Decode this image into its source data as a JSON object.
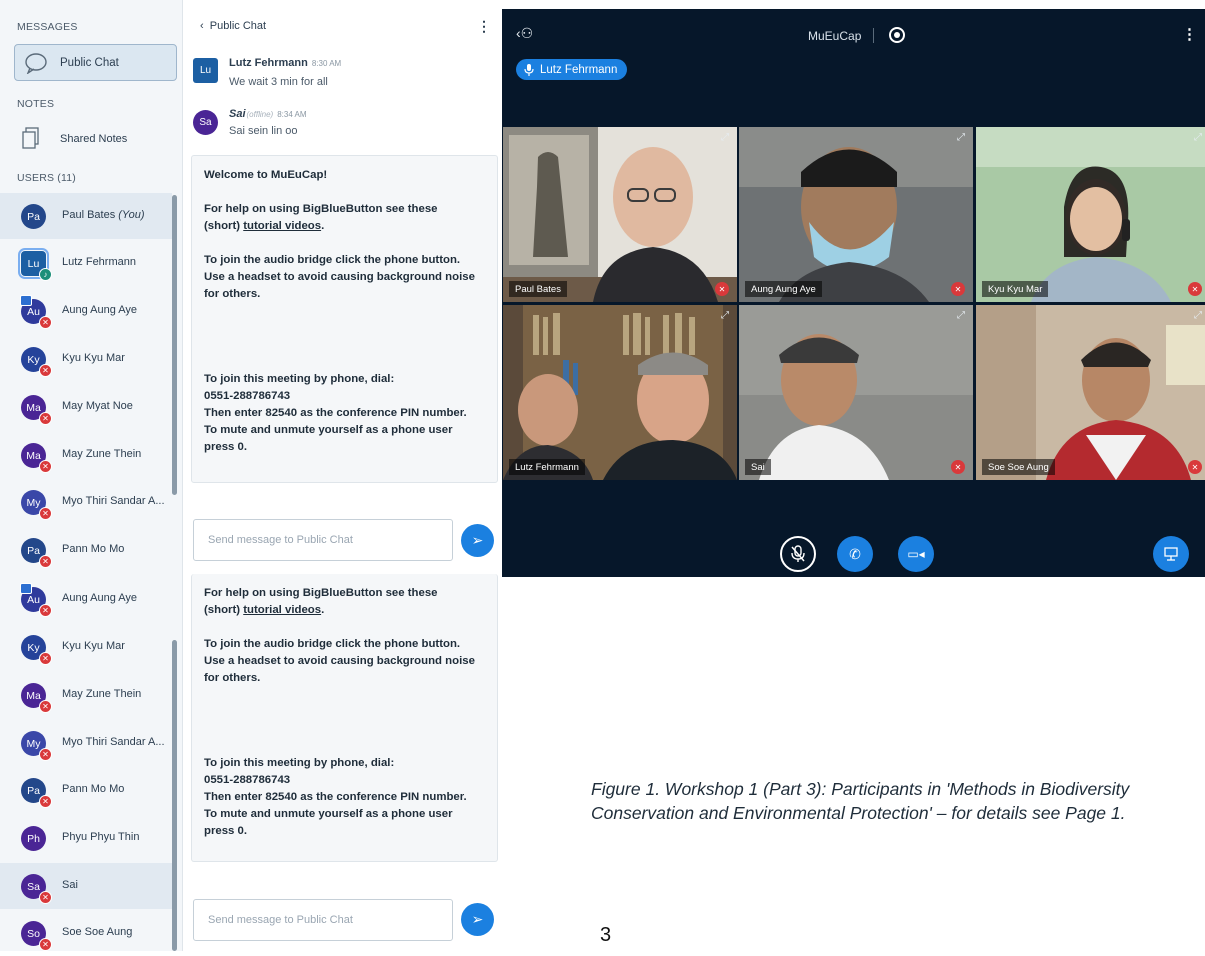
{
  "user_list": {
    "messages_title": "MESSAGES",
    "public_chat_label": "Public Chat",
    "notes_title": "NOTES",
    "shared_notes_label": "Shared Notes",
    "users_title": "USERS (11)",
    "users": [
      {
        "initials": "Pa",
        "name": "Paul Bates",
        "suffix": "(You)",
        "color": "#23478a"
      },
      {
        "initials": "Lu",
        "name": "Lutz Fehrmann",
        "color": "#1c5fa3"
      },
      {
        "initials": "Au",
        "name": "Aung Aung Aye",
        "color": "#2f3a9c"
      },
      {
        "initials": "Ky",
        "name": "Kyu Kyu Mar",
        "color": "#25439a"
      },
      {
        "initials": "Ma",
        "name": "May Myat Noe",
        "color": "#4a2595"
      },
      {
        "initials": "Ma",
        "name": "May Zune Thein",
        "color": "#4a2595"
      },
      {
        "initials": "My",
        "name": "Myo Thiri Sandar A...",
        "color": "#3a47a8"
      },
      {
        "initials": "Pa",
        "name": "Pann Mo Mo",
        "color": "#23478a"
      },
      {
        "initials": "Au",
        "name": "Aung Aung Aye",
        "color": "#2f3a9c"
      },
      {
        "initials": "Ky",
        "name": "Kyu Kyu Mar",
        "color": "#25439a"
      },
      {
        "initials": "Ma",
        "name": "May Zune Thein",
        "color": "#4a2595"
      },
      {
        "initials": "My",
        "name": "Myo Thiri Sandar A...",
        "color": "#3a47a8"
      },
      {
        "initials": "Pa",
        "name": "Pann Mo Mo",
        "color": "#23478a"
      },
      {
        "initials": "Ph",
        "name": "Phyu Phyu Thin",
        "color": "#4a2595"
      },
      {
        "initials": "Sa",
        "name": "Sai",
        "color": "#4a2595"
      },
      {
        "initials": "So",
        "name": "Soe Soe Aung",
        "color": "#4a2595"
      }
    ]
  },
  "chat": {
    "back_label": "Public Chat",
    "messages": [
      {
        "initials": "Lu",
        "name": "Lutz Fehrmann",
        "time": "8:30 AM",
        "text": "We wait 3 min for all"
      },
      {
        "initials": "Sa",
        "name": "Sai",
        "status": "(offline)",
        "time": "8:34 AM",
        "text": "Sai sein lin oo"
      }
    ],
    "welcome_title_prefix": "Welcome to ",
    "welcome_title_name": "MuEuCap",
    "welcome_title_suffix": "!",
    "help_line1": "For help on using BigBlueButton see these",
    "help_line2_prefix": "(short) ",
    "help_link": "tutorial videos",
    "help_line2_suffix": ".",
    "audio_line1": "To join the audio bridge click the phone button.",
    "audio_line2": "Use a headset to avoid causing background noise",
    "audio_line3": "for others.",
    "phone_line1": "To join this meeting by phone, dial:",
    "phone_line2": "0551-288786743",
    "phone_line3": "Then enter 82540 as the conference PIN number.",
    "phone_line4": "To mute and unmute yourself as a phone user",
    "phone_line5": "press 0.",
    "send_placeholder": "Send message to Public Chat"
  },
  "video": {
    "meeting_title": "MuEuCap",
    "talker": "Lutz Fehrmann",
    "tiles": [
      {
        "name": "Paul Bates"
      },
      {
        "name": "Aung Aung Aye"
      },
      {
        "name": "Kyu Kyu Mar"
      },
      {
        "name": "Lutz Fehrmann"
      },
      {
        "name": "Sai"
      },
      {
        "name": "Soe Soe Aung"
      }
    ]
  },
  "caption": {
    "text": "Figure 1. Workshop 1 (Part 3): Participants in 'Methods in Biodiversity Conservation and Environmental Protection' – for details see Page 1.",
    "page_number": "3"
  },
  "colors": {
    "accent": "#1b80e0",
    "video_bg": "#06172a",
    "muted": "#d9393b"
  },
  "icons": [
    "chat-bubble-icon",
    "notes-icon",
    "chevron-left-icon",
    "kebab-icon",
    "send-icon",
    "users-icon",
    "record-icon",
    "microphone-icon",
    "mic-off-icon",
    "phone-icon",
    "camera-icon",
    "presentation-icon",
    "expand-icon"
  ]
}
